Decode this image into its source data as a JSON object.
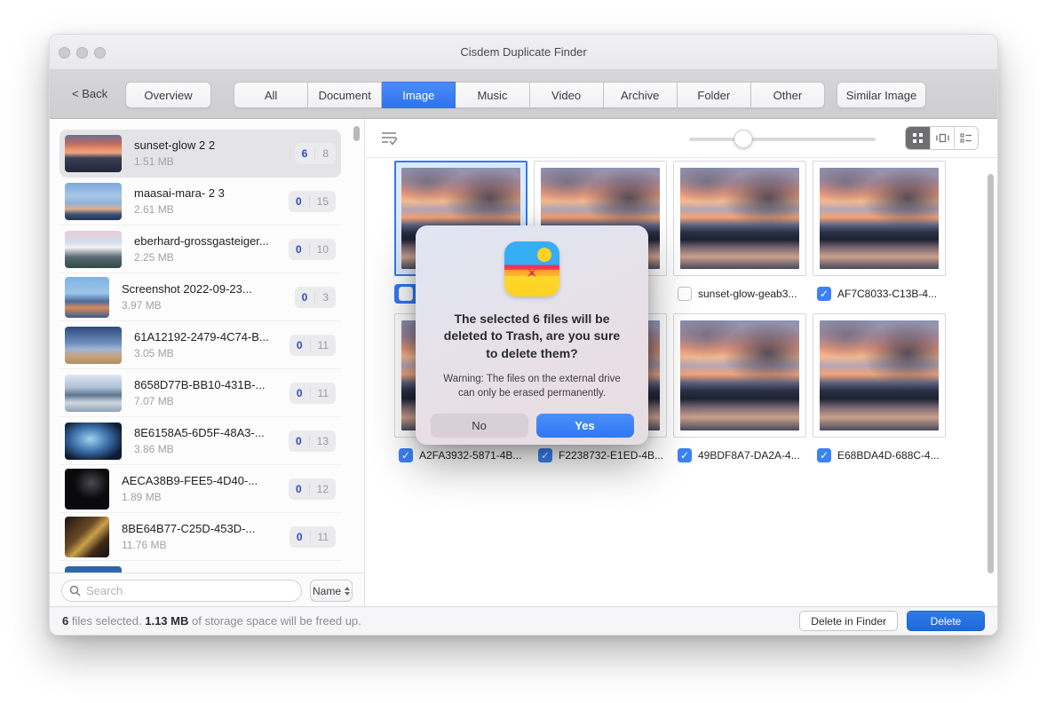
{
  "window": {
    "title": "Cisdem Duplicate Finder"
  },
  "toolbar": {
    "back_label": "< Back",
    "overview_label": "Overview",
    "tabs": [
      {
        "label": "All",
        "active": false
      },
      {
        "label": "Document",
        "active": false
      },
      {
        "label": "Image",
        "active": true
      },
      {
        "label": "Music",
        "active": false
      },
      {
        "label": "Video",
        "active": false
      },
      {
        "label": "Archive",
        "active": false
      },
      {
        "label": "Folder",
        "active": false
      },
      {
        "label": "Other",
        "active": false
      }
    ],
    "similar_image_label": "Similar Image"
  },
  "sidebar": {
    "search_placeholder": "Search",
    "sort_label": "Name",
    "items": [
      {
        "name": "sunset-glow 2 2",
        "size": "1.51 MB",
        "selected_count": "6",
        "total_count": "8",
        "selected": true,
        "thumb": "linear-gradient(180deg,#6b7390 0%,#b96a66 22%,#ef8f66 38%,#e8a58b 48%,#3a3f55 62%,#22263a 100%)"
      },
      {
        "name": "maasai-mara- 2 3",
        "size": "2.61 MB",
        "selected_count": "0",
        "total_count": "15",
        "selected": false,
        "thumb": "linear-gradient(180deg,#7fa8d9 0%,#a8c6e8 35%,#8fb0d8 55%,#e0b08a 70%,#35517a 85%,#24344e 100%)"
      },
      {
        "name": "eberhard-grossgasteiger...",
        "size": "2.25 MB",
        "selected_count": "0",
        "total_count": "10",
        "selected": false,
        "thumb": "linear-gradient(180deg,#e8ccd6 0%,#d4dcec 30%,#f0f2f4 45%,#5b6b75 70%,#2f4a44 100%)"
      },
      {
        "name": "Screenshot 2022-09-23...",
        "size": "3.97 MB",
        "selected_count": "0",
        "total_count": "3",
        "selected": false,
        "square": true,
        "thumb": "linear-gradient(180deg,#7fb3e0 0%,#9cc4ea 40%,#4a6c9c 60%,#d98a5a 75%,#3a5c8c 100%)"
      },
      {
        "name": "61A12192-2479-4C74-B...",
        "size": "3.05 MB",
        "selected_count": "0",
        "total_count": "11",
        "selected": false,
        "thumb": "linear-gradient(180deg,#2f4a7a 0%,#6f8fc0 45%,#9fb4d4 60%,#c9a37a 80%,#b08c60 100%)"
      },
      {
        "name": "8658D77B-BB10-431B-...",
        "size": "7.07 MB",
        "selected_count": "0",
        "total_count": "11",
        "selected": false,
        "thumb": "linear-gradient(180deg,#dfe8f2 0%,#aebfd4 35%,#5d7590 55%,#cfd8e2 75%,#8fa3b5 100%)"
      },
      {
        "name": "8E6158A5-6D5F-48A3-...",
        "size": "3.86 MB",
        "selected_count": "0",
        "total_count": "13",
        "selected": false,
        "thumb": "radial-gradient(60% 60% at 45% 45%, #9fd4f0 0%, #3a6ea8 55%, #0e1c33 100%)"
      },
      {
        "name": "AECA38B9-FEE5-4D40-...",
        "size": "1.89 MB",
        "selected_count": "0",
        "total_count": "12",
        "selected": false,
        "square": true,
        "thumb": "radial-gradient(40% 40% at 60% 35%, #4a4a52 0%, #1a1a1e 70%, #0a0a0c 100%)"
      },
      {
        "name": "8BE64B77-C25D-453D-...",
        "size": "11.76 MB",
        "selected_count": "0",
        "total_count": "11",
        "selected": false,
        "square": true,
        "thumb": "linear-gradient(135deg,#1c1410 0%,#6b4a26 40%,#caa04c 55%,#3d2a18 75%,#15100c 100%)"
      },
      {
        "name": "",
        "size": "",
        "selected_count": "",
        "total_count": "",
        "selected": false,
        "thumb": "linear-gradient(180deg,#2e62a8 0%,#4b86c9 100%)"
      }
    ]
  },
  "grid_toolbar": {
    "slider_position": "29%",
    "active_view": "grid"
  },
  "grid": {
    "rows": [
      {
        "cards": [
          {
            "label": "",
            "checked": true,
            "selected": true,
            "occluded": true
          },
          {
            "label": "",
            "checked": true,
            "selected": false,
            "occluded": true
          },
          {
            "label": "sunset-glow-geab3...",
            "checked": false,
            "selected": false
          },
          {
            "label": "AF7C8033-C13B-4...",
            "checked": true,
            "selected": false
          }
        ]
      },
      {
        "cards": [
          {
            "label": "A2FA3932-5871-4B...",
            "checked": true,
            "selected": false
          },
          {
            "label": "F2238732-E1ED-4B...",
            "checked": true,
            "selected": false
          },
          {
            "label": "49BDF8A7-DA2A-4...",
            "checked": true,
            "selected": false
          },
          {
            "label": "E68BDA4D-688C-4...",
            "checked": true,
            "selected": false
          }
        ]
      }
    ]
  },
  "dialog": {
    "title": "The selected 6 files will be deleted to Trash, are you sure to delete them?",
    "warning": "Warning: The files on the external drive can only be erased permanently.",
    "no_label": "No",
    "yes_label": "Yes"
  },
  "footer": {
    "status_count": "6",
    "status_text1": " files selected. ",
    "status_size": "1.13 MB",
    "status_text2": " of storage space will be freed up.",
    "delete_in_finder_label": "Delete in Finder",
    "delete_label": "Delete"
  },
  "colors": {
    "accent_blue": "#3478f6",
    "checkbox_blue": "#3b82f7",
    "badge_blue": "#2c49c9",
    "delete_button_blue": "#1d6add"
  }
}
